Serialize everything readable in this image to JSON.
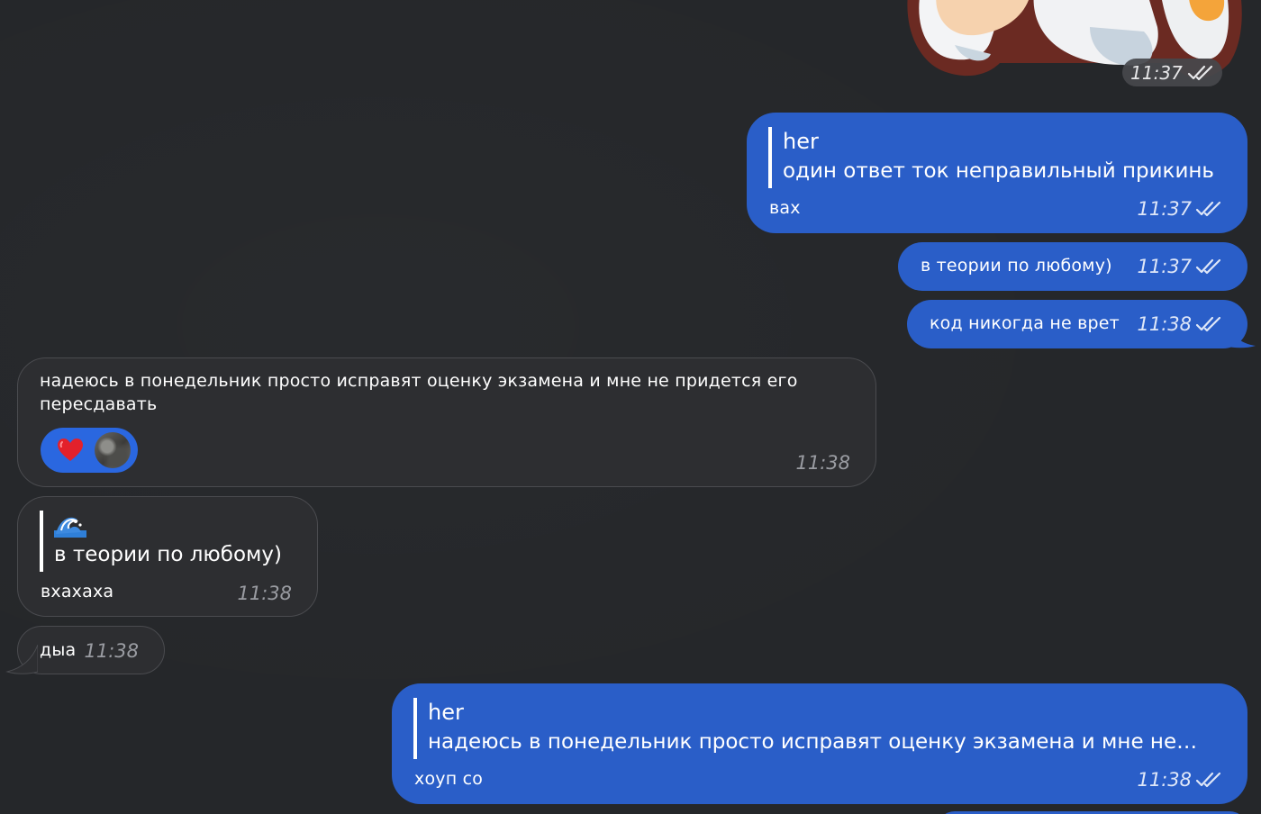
{
  "sticker": {
    "icon": "cartoon-sticker",
    "time": "11:37"
  },
  "messages": [
    {
      "direction": "outgoing",
      "reply_to": {
        "name": "her",
        "text": "один ответ ток неправильный прикинь"
      },
      "text": "вах",
      "time": "11:37",
      "status": "read"
    },
    {
      "direction": "outgoing",
      "text": "в теории по любому)",
      "time": "11:37",
      "status": "read"
    },
    {
      "direction": "outgoing",
      "text": "код никогда не врет",
      "time": "11:38",
      "status": "read"
    },
    {
      "direction": "incoming",
      "text": "надеюсь в понедельник просто исправят оценку экзамена и мне не придется его пересдавать",
      "time": "11:38",
      "reactions": [
        {
          "emoji": "❤️",
          "icon": "red-heart"
        },
        {
          "icon": "reactor-avatar"
        }
      ]
    },
    {
      "direction": "incoming",
      "reply_to": {
        "name": "🌊",
        "icon": "water-wave",
        "text": "в теории по любому)"
      },
      "text": "вхахаха",
      "time": "11:38"
    },
    {
      "direction": "incoming",
      "text": "дыа",
      "time": "11:38"
    },
    {
      "direction": "outgoing",
      "reply_to": {
        "name": "her",
        "text": "надеюсь в понедельник просто исправят оценку экзамена и мне не…"
      },
      "text": "хоуп со",
      "time": "11:38",
      "status": "read"
    }
  ],
  "colors": {
    "background": "#25272a",
    "outgoing_bubble": "#2a5ec8",
    "incoming_bubble": "#2d2e31",
    "reaction_pill": "#2a67e0"
  }
}
